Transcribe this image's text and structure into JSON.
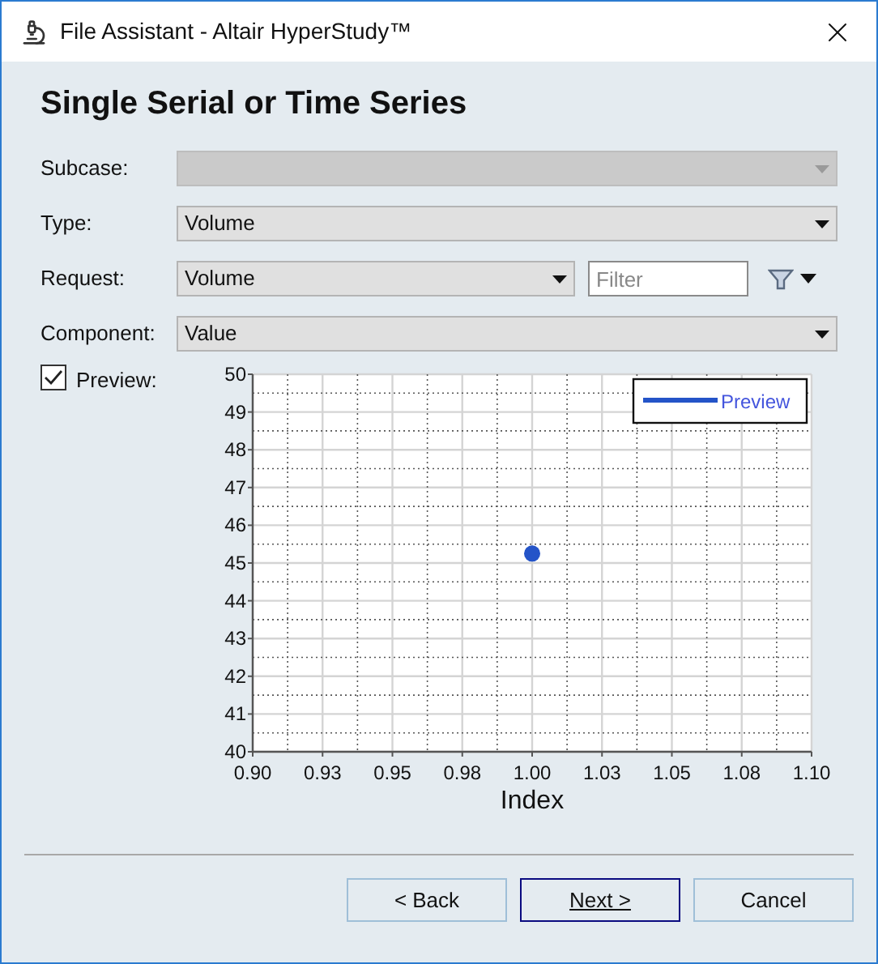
{
  "window": {
    "title": "File Assistant - Altair HyperStudy™"
  },
  "heading": "Single Serial or Time Series",
  "fields": [
    {
      "label": "Subcase:",
      "disabled": true,
      "filter": false
    },
    {
      "label": "Type:",
      "value": "Volume",
      "disabled": false,
      "filter": false
    },
    {
      "label": "Request:",
      "value": "Volume",
      "disabled": false,
      "filter": true,
      "filter_placeholder": "Filter"
    },
    {
      "label": "Component:",
      "value": "Value",
      "disabled": false,
      "filter": false
    }
  ],
  "preview": {
    "label": "Preview:",
    "checked": true
  },
  "chart_data": {
    "type": "scatter",
    "grid": true,
    "xlabel": "Index",
    "x": [
      1.0
    ],
    "series": [
      {
        "name": "Preview",
        "color": "#2454c8",
        "values": [
          45.25
        ]
      }
    ],
    "xlim": [
      0.9,
      1.1
    ],
    "ylim": [
      40,
      50
    ],
    "xticks": [
      {
        "value": 0.9,
        "label": "0.90"
      },
      {
        "value": 0.925,
        "label": "0.93"
      },
      {
        "value": 0.95,
        "label": "0.95"
      },
      {
        "value": 0.975,
        "label": "0.98"
      },
      {
        "value": 1.0,
        "label": "1.00"
      },
      {
        "value": 1.025,
        "label": "1.03"
      },
      {
        "value": 1.05,
        "label": "1.05"
      },
      {
        "value": 1.075,
        "label": "1.08"
      },
      {
        "value": 1.1,
        "label": "1.10"
      }
    ],
    "yticks": [
      40,
      41,
      42,
      43,
      44,
      45,
      46,
      47,
      48,
      49,
      50
    ]
  },
  "buttons": [
    {
      "label": "< Back",
      "default": false
    },
    {
      "label": "Next >",
      "default": true
    },
    {
      "label": "Cancel",
      "default": false
    }
  ]
}
